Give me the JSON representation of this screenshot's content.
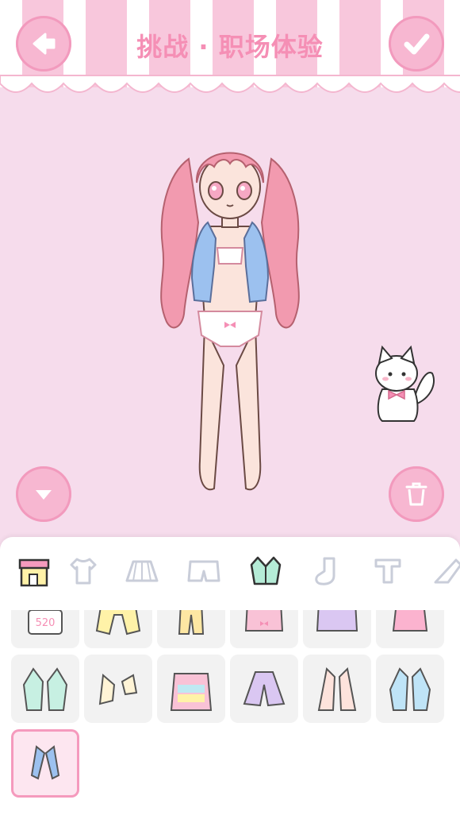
{
  "header": {
    "title": "挑战 · 职场体验"
  },
  "buttons": {
    "back": "back-arrow-icon",
    "confirm": "check-icon",
    "collapse": "chevron-down-icon",
    "clear": "trash-icon"
  },
  "tabs": [
    {
      "name": "shop",
      "active": true
    },
    {
      "name": "tshirt"
    },
    {
      "name": "skirt"
    },
    {
      "name": "shorts"
    },
    {
      "name": "jacket",
      "selected": true
    },
    {
      "name": "socks"
    },
    {
      "name": "top"
    },
    {
      "name": "shoes"
    }
  ],
  "items": [
    {
      "name": "apron-520",
      "text": "520",
      "row": 0
    },
    {
      "name": "yellow-jacket",
      "row": 0
    },
    {
      "name": "yellow-pants",
      "row": 0
    },
    {
      "name": "pink-bow-coat",
      "row": 0
    },
    {
      "name": "purple-hoodie",
      "row": 0
    },
    {
      "name": "pink-cardigan",
      "row": 0
    },
    {
      "name": "mint-star-jacket",
      "row": 1
    },
    {
      "name": "cream-bolero",
      "row": 1
    },
    {
      "name": "rainbow-hoodie",
      "row": 1
    },
    {
      "name": "purple-cape",
      "row": 1
    },
    {
      "name": "peach-coat",
      "row": 1
    },
    {
      "name": "blue-laced-jacket",
      "row": 1
    },
    {
      "name": "blue-cardigan",
      "row": 2,
      "selected": true
    }
  ],
  "colors": {
    "accent": "#f58fb5",
    "background": "#f6dcec",
    "button": "#f7b7d1",
    "jacket": "#9cc1ef",
    "hair": "#f29aaf"
  }
}
